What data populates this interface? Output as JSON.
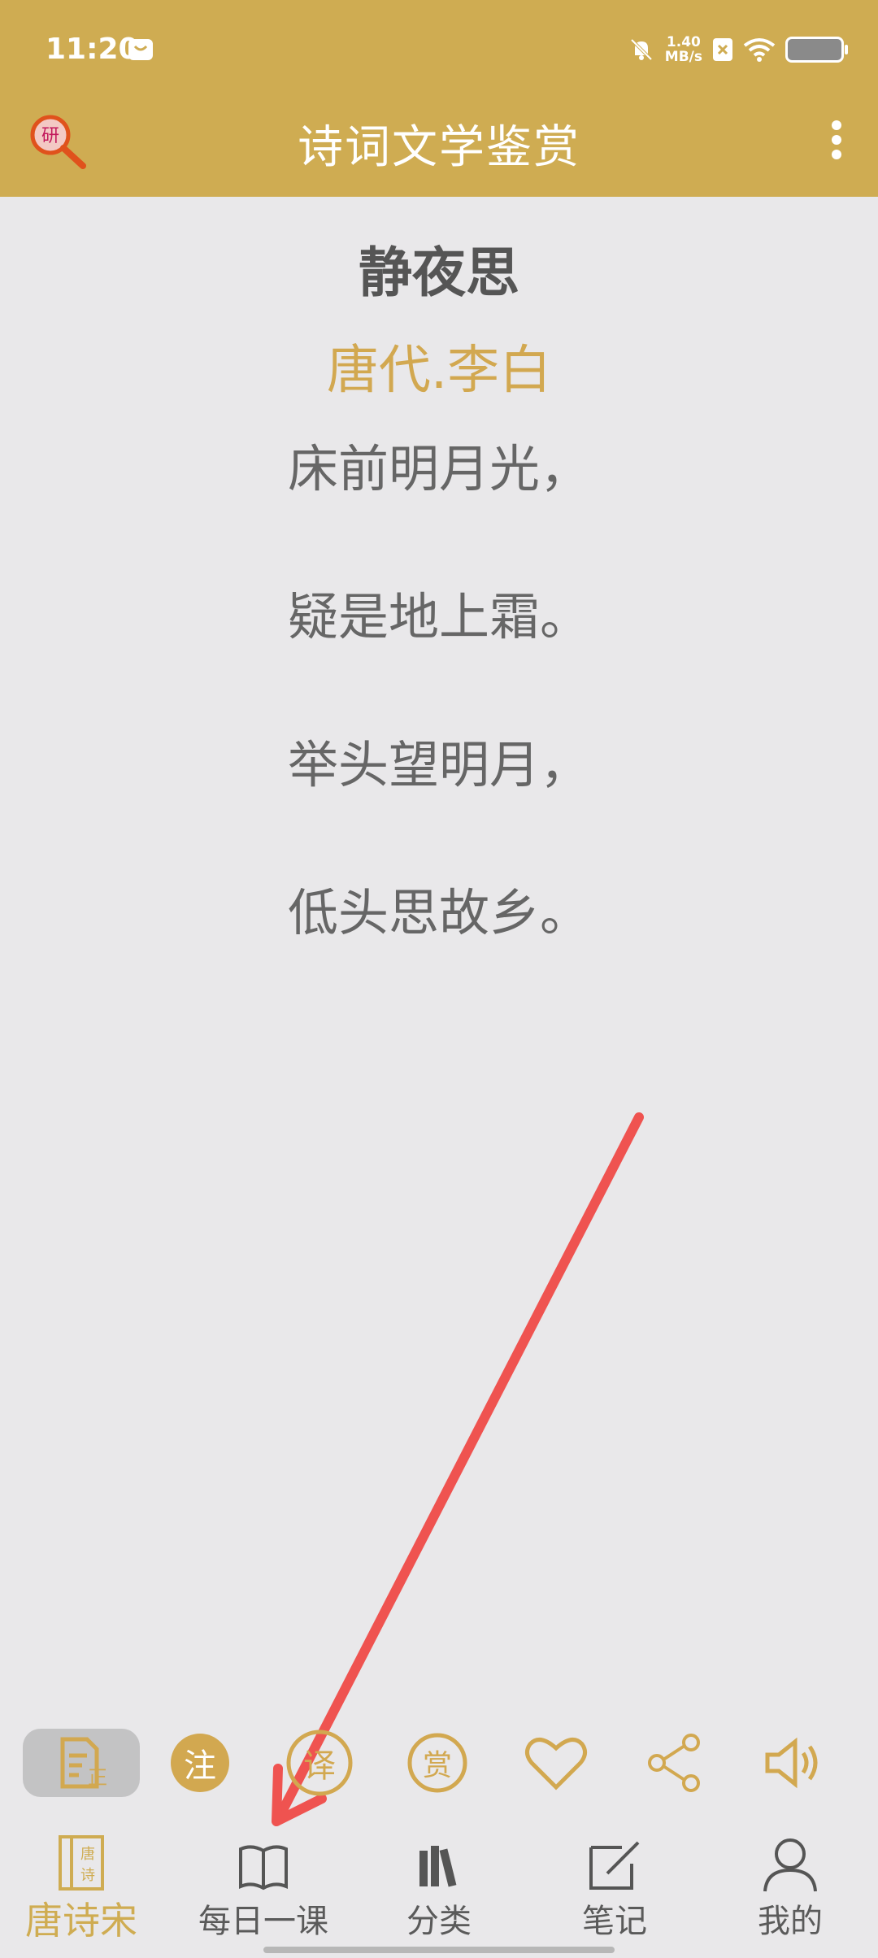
{
  "status_bar": {
    "time": "11:20",
    "net_speed_value": "1.40",
    "net_speed_unit": "MB/s"
  },
  "header": {
    "title": "诗词文学鉴赏",
    "logo_text": "研"
  },
  "poem": {
    "title": "静夜思",
    "author": "唐代.李白",
    "lines": [
      "床前明月光，",
      "疑是地上霜。",
      "举头望明月，",
      "低头思故乡。"
    ]
  },
  "toolbar": {
    "correct_badge": "正",
    "annotate": "注",
    "translate": "译",
    "appreciate": "赏"
  },
  "tabs": [
    {
      "label": "唐诗宋",
      "icon_text_top": "唐",
      "icon_text_bottom": "诗"
    },
    {
      "label": "每日一课"
    },
    {
      "label": "分类"
    },
    {
      "label": "笔记"
    },
    {
      "label": "我的"
    }
  ],
  "colors": {
    "accent": "#cfac52",
    "background": "#e9e8ea",
    "annotation_arrow": "#ef5350"
  }
}
